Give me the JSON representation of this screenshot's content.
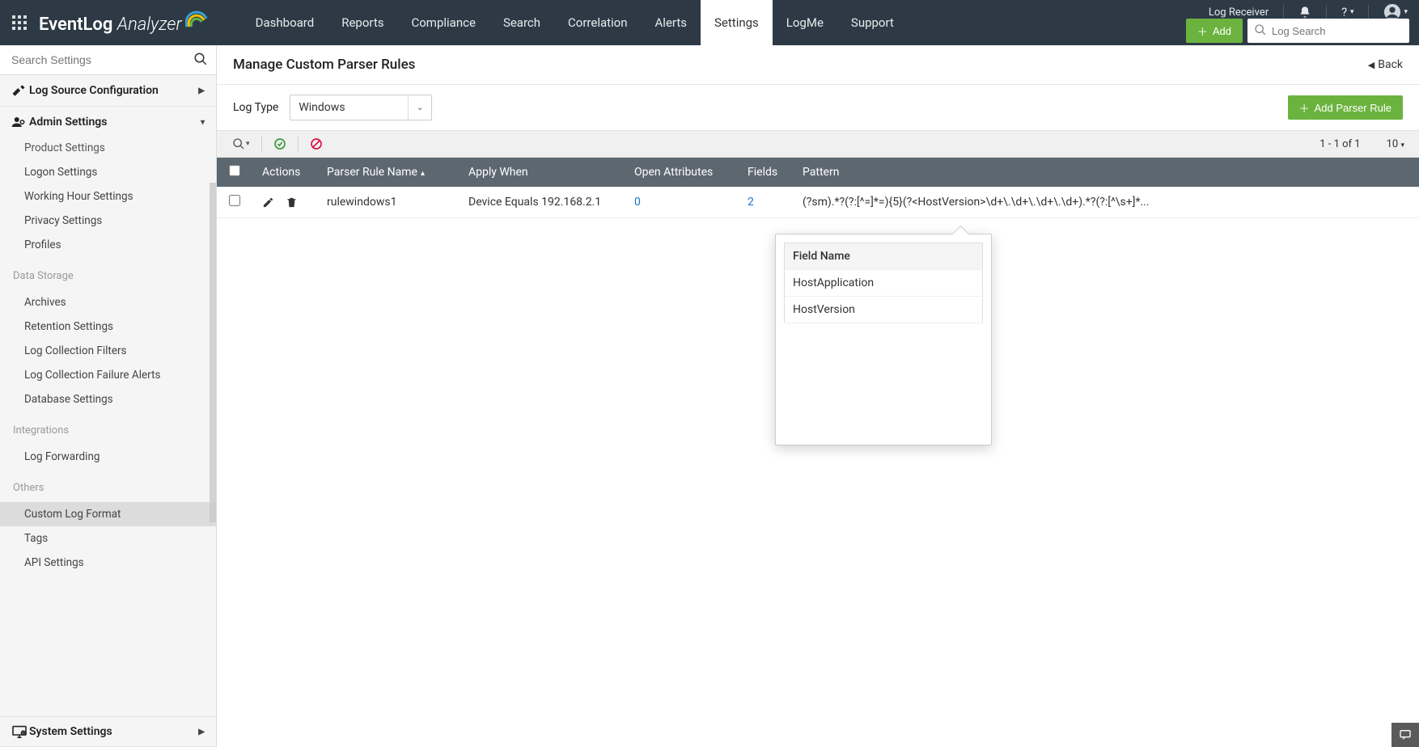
{
  "header": {
    "brand_a": "EventLog",
    "brand_b": "Analyzer",
    "log_receiver": "Log Receiver",
    "add_label": "Add",
    "search_placeholder": "Log Search",
    "help_symbol": "?"
  },
  "nav": {
    "items": [
      "Dashboard",
      "Reports",
      "Compliance",
      "Search",
      "Correlation",
      "Alerts",
      "Settings",
      "LogMe",
      "Support"
    ],
    "active": "Settings"
  },
  "sidebar": {
    "search_placeholder": "Search Settings",
    "sections": {
      "log_source": "Log Source Configuration",
      "admin": "Admin Settings",
      "system": "System Settings"
    },
    "admin_items_top": [
      "Product Settings",
      "Logon Settings",
      "Working Hour Settings",
      "Privacy Settings",
      "Profiles"
    ],
    "data_storage_label": "Data Storage",
    "data_storage_items": [
      "Archives",
      "Retention Settings",
      "Log Collection Filters",
      "Log Collection Failure Alerts",
      "Database Settings"
    ],
    "integrations_label": "Integrations",
    "integrations_items": [
      "Log Forwarding"
    ],
    "others_label": "Others",
    "others_items": [
      "Custom Log Format",
      "Tags",
      "API Settings"
    ],
    "active_item": "Custom Log Format"
  },
  "page": {
    "title": "Manage Custom Parser Rules",
    "back": "Back",
    "log_type_label": "Log Type",
    "log_type_value": "Windows",
    "add_rule": "Add Parser Rule"
  },
  "toolbar": {
    "page_info": "1 - 1 of 1",
    "page_size": "10"
  },
  "columns": {
    "actions": "Actions",
    "name": "Parser Rule Name",
    "apply_when": "Apply When",
    "open_attributes": "Open Attributes",
    "fields": "Fields",
    "pattern": "Pattern"
  },
  "rows": [
    {
      "name": "rulewindows1",
      "apply_when": "Device Equals 192.168.2.1",
      "open_attributes": "0",
      "fields": "2",
      "pattern": "(?sm).*?(?:[^=]*=){5}(?<HostVersion>\\d+\\.\\d+\\.\\d+\\.\\d+).*?(?:[^\\s+]*..."
    }
  ],
  "popover": {
    "header": "Field Name",
    "items": [
      "HostApplication",
      "HostVersion"
    ]
  }
}
